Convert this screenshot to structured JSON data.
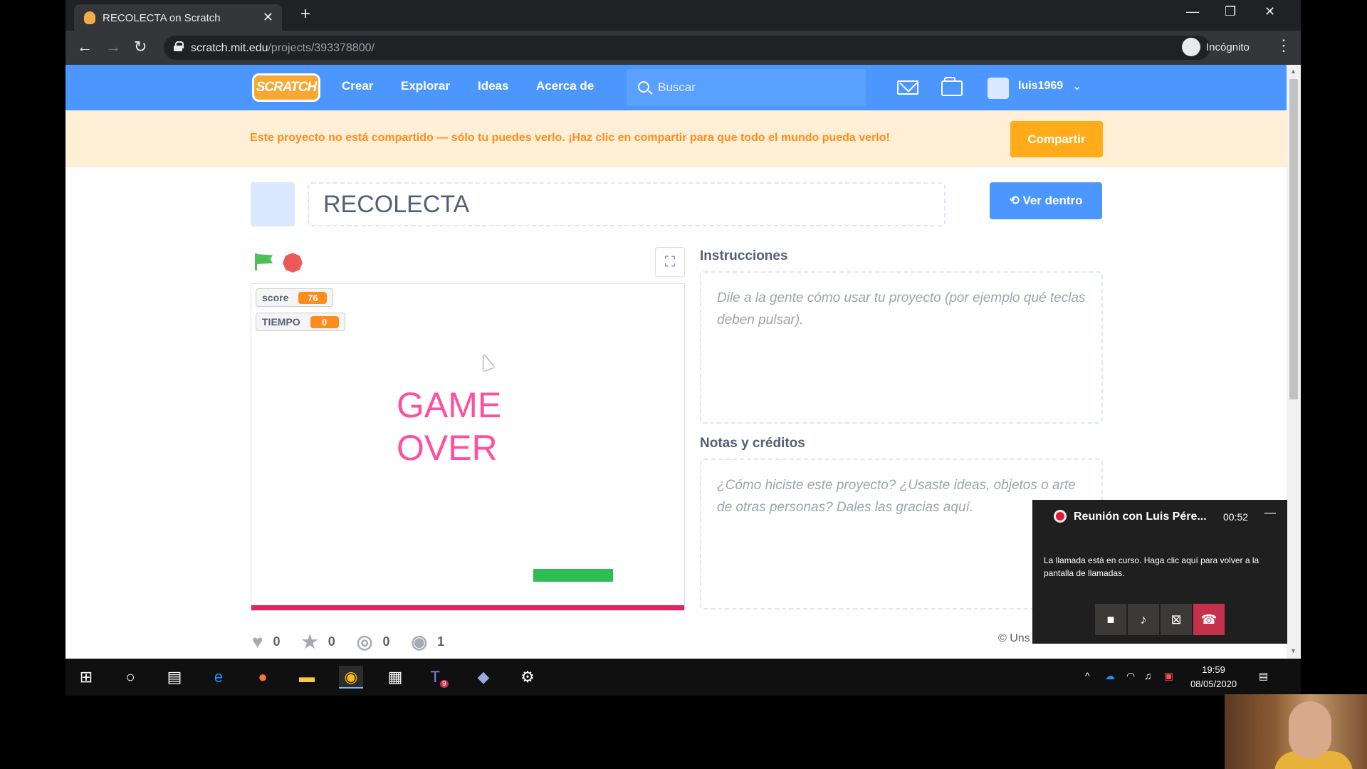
{
  "browser": {
    "tab_title": "RECOLECTA on Scratch",
    "url_host": "scratch.mit.edu",
    "url_path": "/projects/393378800/",
    "incognito_label": "Incógnito"
  },
  "scratch_nav": {
    "logo_text": "SCRATCH",
    "links": [
      "Crear",
      "Explorar",
      "Ideas",
      "Acerca de"
    ],
    "search_placeholder": "Buscar",
    "username": "luis1969"
  },
  "banner": {
    "message": "Este proyecto no está compartido — sólo tu puedes verlo. ¡Haz clic en compartir para que todo el mundo pueda verlo!",
    "share_label": "Compartir"
  },
  "project": {
    "title": "RECOLECTA",
    "see_inside_label": "Ver dentro"
  },
  "stage": {
    "monitors": [
      {
        "label": "score",
        "value": "76"
      },
      {
        "label": "TIEMPO",
        "value": "0"
      }
    ],
    "game_over_line1": "GAME",
    "game_over_line2": "OVER"
  },
  "stats": {
    "loves": "0",
    "favorites": "0",
    "remixes": "0",
    "views": "1"
  },
  "instructions": {
    "heading": "Instrucciones",
    "placeholder": "Dile a la gente cómo usar tu proyecto (por ejemplo qué teclas deben pulsar)."
  },
  "notes": {
    "heading": "Notas y créditos",
    "placeholder": "¿Cómo hiciste este proyecto? ¿Usaste ideas, objetos o arte de otras personas? Dales las gracias aquí."
  },
  "copyright_fragment": "© Uns",
  "call": {
    "title": "Reunión con Luis Pére...",
    "duration": "00:52",
    "info": "La llamada está en curso. Haga clic aquí para volver a la pantalla de llamadas."
  },
  "taskbar": {
    "teams_badge": "9",
    "time": "19:59",
    "date": "08/05/2020"
  },
  "colors": {
    "scratch_blue": "#4c97ff",
    "share_orange": "#ffab1a",
    "game_over_pink": "#ff4fa0",
    "paddle_green": "#2ebd52",
    "floor_red": "#e0245e",
    "call_end_red": "#c4314b"
  },
  "icons": [
    "flag-icon",
    "stop-icon",
    "fullscreen-icon",
    "heart-icon",
    "star-icon",
    "remix-icon",
    "eye-icon",
    "mail-icon",
    "folder-icon",
    "search-icon"
  ]
}
